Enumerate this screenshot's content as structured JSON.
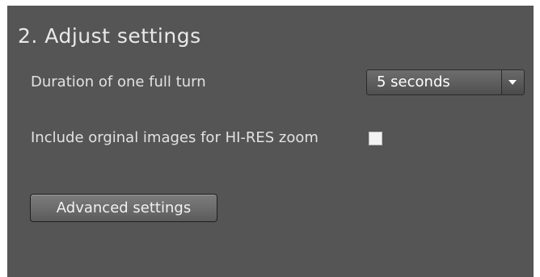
{
  "section": {
    "title": "2. Adjust settings"
  },
  "duration": {
    "label": "Duration of one full turn",
    "selected_value": "5 seconds"
  },
  "hires": {
    "label": "Include orginal images for HI-RES zoom",
    "checked": false
  },
  "advanced": {
    "button_label": "Advanced settings"
  },
  "colors": {
    "panel_background": "#555555",
    "text": "#e2e2e2"
  },
  "icons": {
    "dropdown": "chevron-down-icon"
  }
}
